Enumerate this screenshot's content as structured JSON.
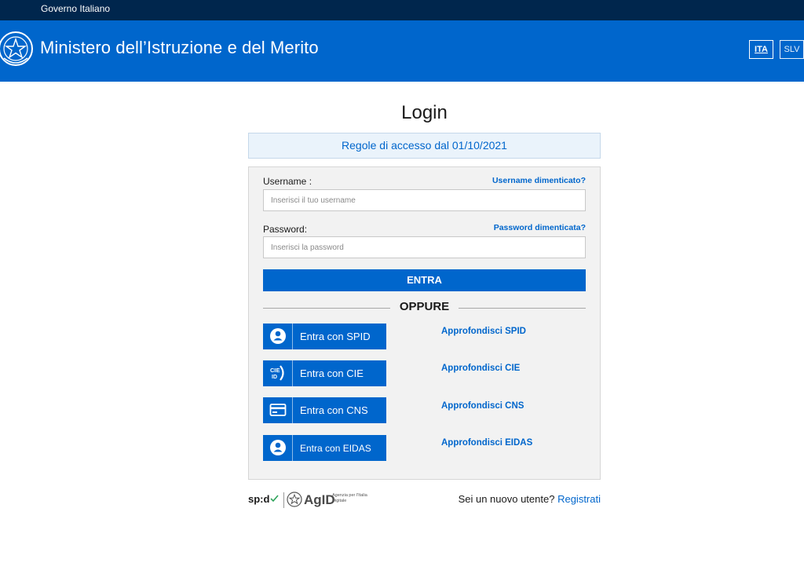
{
  "topbar": {
    "gov_label": "Governo Italiano"
  },
  "header": {
    "ministry": "Ministero dell’Istruzione e del Merito",
    "lang": [
      "ITA",
      "SLV"
    ]
  },
  "page": {
    "title": "Login"
  },
  "rules": {
    "label": "Regole di accesso dal 01/10/2021"
  },
  "form": {
    "username_label": "Username :",
    "username_forgot": "Username dimenticato?",
    "username_placeholder": "Inserisci il tuo username",
    "username_value": "",
    "password_label": "Password:",
    "password_forgot": "Password dimenticata?",
    "password_placeholder": "Inserisci la password",
    "password_value": "",
    "submit_label": "ENTRA",
    "or_label": "OPPURE"
  },
  "auth": [
    {
      "label": "Entra con SPID",
      "icon": "user-circle-icon",
      "learn": "Approfondisci SPID"
    },
    {
      "label": "Entra con CIE",
      "icon": "cie-id-icon",
      "learn": "Approfondisci CIE"
    },
    {
      "label": "Entra con CNS",
      "icon": "card-icon",
      "learn": "Approfondisci CNS"
    },
    {
      "label": "Entra con EIDAS",
      "icon": "user-circle-icon",
      "learn": "Approfondisci EIDAS"
    }
  ],
  "footer": {
    "spid_logo": "sp:d",
    "agid_logo": "AgID",
    "agid_subtitle": "Agenzia per l'Italia Digitale",
    "new_user_text": "Sei un nuovo utente?",
    "register_label": "Registrati"
  },
  "colors": {
    "topbar": "#00264d",
    "header": "#0066cc",
    "accent": "#0066cc",
    "panel": "#f2f2f2",
    "spid_check": "#2ea35a"
  }
}
